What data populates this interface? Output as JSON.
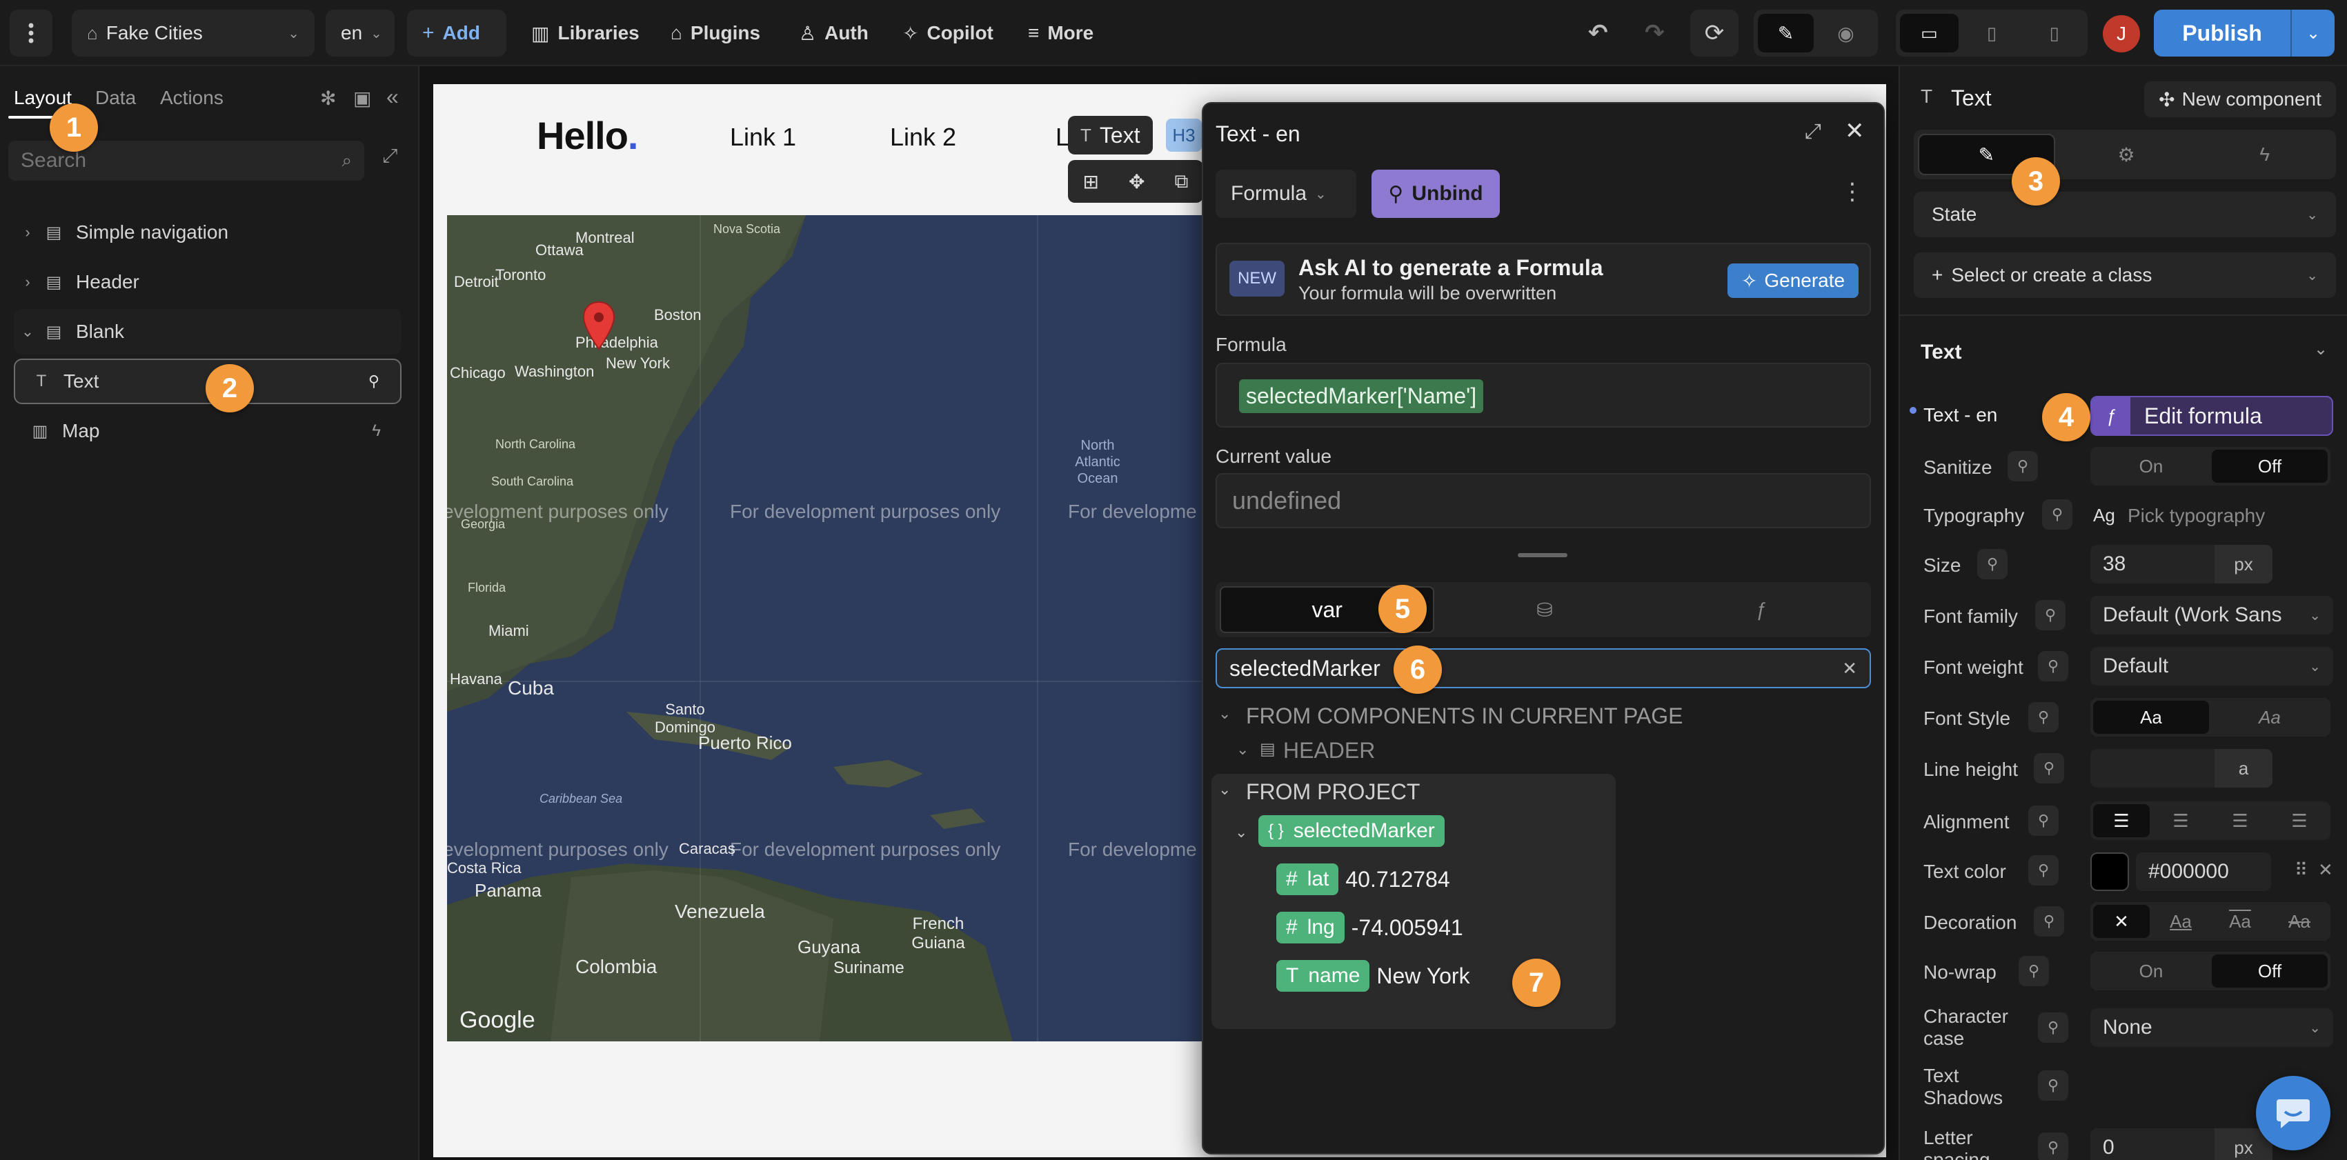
{
  "topbar": {
    "project_name": "Fake Cities",
    "lang": "en",
    "add": "Add",
    "libraries": "Libraries",
    "plugins": "Plugins",
    "auth": "Auth",
    "copilot": "Copilot",
    "more": "More",
    "avatar_letter": "J",
    "publish": "Publish"
  },
  "left_panel": {
    "tabs": [
      "Layout",
      "Data",
      "Actions"
    ],
    "search_placeholder": "Search",
    "tree": [
      {
        "label": "Simple navigation"
      },
      {
        "label": "Header"
      },
      {
        "label": "Blank"
      },
      {
        "label": "Text"
      },
      {
        "label": "Map"
      }
    ]
  },
  "canvas": {
    "logo": "Hello",
    "logo_dot": ".",
    "links": [
      "Link 1",
      "Link 2",
      "L"
    ],
    "selection_label": "Text",
    "selection_tag": "H3",
    "map": {
      "cities": [
        "Montreal",
        "Ottawa",
        "Toronto",
        "Boston",
        "Detroit",
        "Chicago",
        "Washington",
        "New York",
        "Philadelphia",
        "North Carolina",
        "South Carolina",
        "Georgia",
        "Florida",
        "Miami",
        "Havana",
        "Cuba",
        "Santo Domingo",
        "Puerto Rico",
        "Caribbean Sea",
        "Caracas",
        "Venezuela",
        "Guyana",
        "Suriname",
        "French Guiana",
        "Panama",
        "Colombia",
        "Costa Rica",
        "Nova Scotia",
        "North Atlantic Ocean"
      ],
      "watermark": "For development purposes only",
      "watermark_cut_left": "evelopment purposes only",
      "watermark_cut_right": "For developme",
      "google": "Google"
    }
  },
  "formula_panel": {
    "title": "Text - en",
    "mode": "Formula",
    "unbind": "Unbind",
    "ai_badge": "NEW",
    "ai_title": "Ask AI to generate a Formula",
    "ai_subtitle": "Your formula will be overwritten",
    "generate": "Generate",
    "formula_label": "Formula",
    "formula_value": "selectedMarker['Name']",
    "current_label": "Current value",
    "current_value": "undefined",
    "tab_var": "var",
    "search_value": "selectedMarker",
    "section_components": "FROM COMPONENTS IN CURRENT PAGE",
    "header_item": "HEADER",
    "section_project": "FROM PROJECT",
    "var_name": "selectedMarker",
    "fields": [
      {
        "key": "lat",
        "value": "40.712784"
      },
      {
        "key": "lng",
        "value": "-74.005941"
      },
      {
        "key": "name",
        "value": "New York"
      }
    ]
  },
  "right_panel": {
    "element_title": "Text",
    "new_component": "New component",
    "state": "State",
    "class_select": "Select or create a class",
    "section_text": "Text",
    "text_en_label": "Text - en",
    "edit_formula": "Edit formula",
    "sanitize": "Sanitize",
    "on": "On",
    "off": "Off",
    "typography": "Typography",
    "pick_typography": "Pick typography",
    "typography_ag": "Ag",
    "size": "Size",
    "size_value": "38",
    "size_unit": "px",
    "font_family": "Font family",
    "font_family_value": "Default (Work Sans",
    "font_weight": "Font weight",
    "font_weight_value": "Default",
    "font_style": "Font Style",
    "aa": "Aa",
    "line_height": "Line height",
    "line_height_unit": "a",
    "alignment": "Alignment",
    "text_color": "Text color",
    "text_color_value": "#000000",
    "decoration": "Decoration",
    "no_wrap": "No-wrap",
    "character_case": "Character case",
    "character_case_value": "None",
    "text_shadows": "Text Shadows",
    "letter_spacing": "Letter spacing",
    "letter_value": "0",
    "letter_unit": "px"
  },
  "badges": [
    "1",
    "2",
    "3",
    "4",
    "5",
    "6",
    "7"
  ],
  "colors": {
    "publish": "#3b82d6",
    "accent_green": "#4eb37a",
    "badge": "#f29a3b",
    "unbind": "#8e7bd1",
    "formula_purple": "#6b52b8"
  }
}
